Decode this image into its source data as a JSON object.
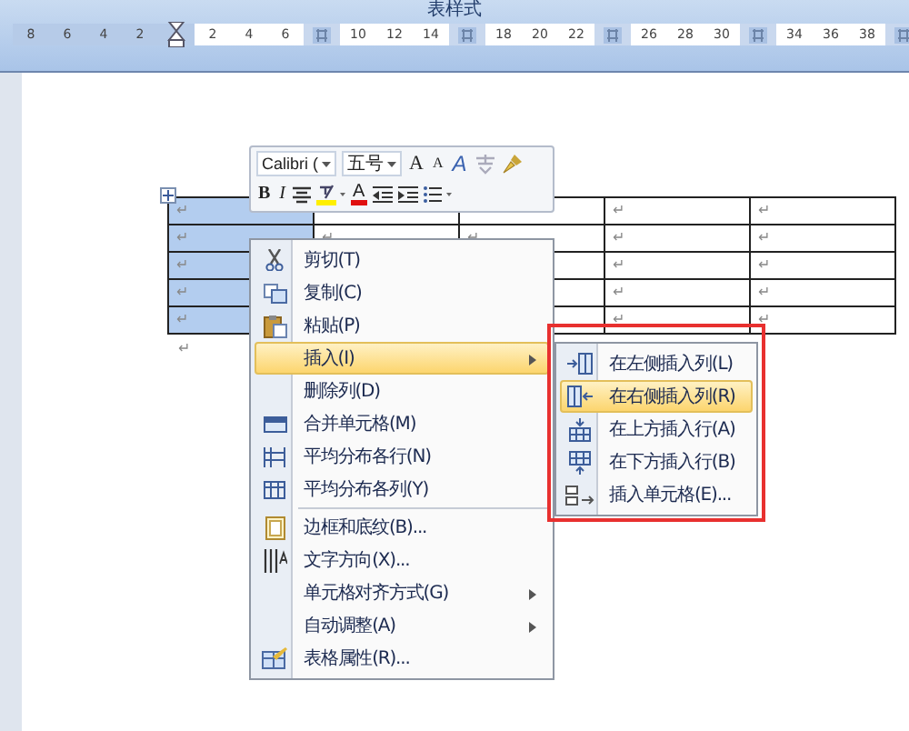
{
  "title": "表样式",
  "ruler": [
    {
      "kind": "number",
      "label": "8",
      "in_margin": true
    },
    {
      "kind": "number",
      "label": "6",
      "in_margin": true
    },
    {
      "kind": "number",
      "label": "4",
      "in_margin": true
    },
    {
      "kind": "number",
      "label": "2",
      "in_margin": true
    },
    {
      "kind": "indent_marker"
    },
    {
      "kind": "number",
      "label": "2",
      "in_margin": false
    },
    {
      "kind": "number",
      "label": "4",
      "in_margin": false
    },
    {
      "kind": "number",
      "label": "6",
      "in_margin": false
    },
    {
      "kind": "column_marker"
    },
    {
      "kind": "number",
      "label": "10",
      "in_margin": false
    },
    {
      "kind": "number",
      "label": "12",
      "in_margin": false
    },
    {
      "kind": "number",
      "label": "14",
      "in_margin": false
    },
    {
      "kind": "column_marker"
    },
    {
      "kind": "number",
      "label": "18",
      "in_margin": false
    },
    {
      "kind": "number",
      "label": "20",
      "in_margin": false
    },
    {
      "kind": "number",
      "label": "22",
      "in_margin": false
    },
    {
      "kind": "column_marker"
    },
    {
      "kind": "number",
      "label": "26",
      "in_margin": false
    },
    {
      "kind": "number",
      "label": "28",
      "in_margin": false
    },
    {
      "kind": "number",
      "label": "30",
      "in_margin": false
    },
    {
      "kind": "column_marker"
    },
    {
      "kind": "number",
      "label": "34",
      "in_margin": false
    },
    {
      "kind": "number",
      "label": "36",
      "in_margin": false
    },
    {
      "kind": "number",
      "label": "38",
      "in_margin": false
    },
    {
      "kind": "column_marker"
    }
  ],
  "table": {
    "rows": [
      [
        {
          "text": "↵",
          "selected": true
        },
        {},
        {},
        {
          "text": "↵",
          "selected": false
        },
        {
          "text": "↵",
          "selected": false
        }
      ],
      [
        {
          "text": "↵",
          "selected": true
        },
        {
          "text": "↵",
          "selected": false
        },
        {
          "text": "↵",
          "selected": false
        },
        {
          "text": "↵",
          "selected": false
        },
        {
          "text": "↵",
          "selected": false
        }
      ],
      [
        {
          "text": "↵",
          "selected": true
        },
        {},
        {},
        {
          "text": "↵",
          "selected": false
        },
        {
          "text": "↵",
          "selected": false
        }
      ],
      [
        {
          "text": "↵",
          "selected": true
        },
        {},
        {},
        {
          "text": "↵",
          "selected": false
        },
        {
          "text": "↵",
          "selected": false
        }
      ],
      [
        {
          "text": "↵",
          "selected": true
        },
        {},
        {},
        {
          "text": "↵",
          "selected": false
        },
        {
          "text": "↵",
          "selected": false
        }
      ]
    ],
    "after_mark": "↵"
  },
  "mini_toolbar": {
    "top_row": [
      {
        "kind": "font_field",
        "label": "Calibri ("
      },
      {
        "kind": "size_field",
        "label": "五号"
      },
      {
        "kind": "grow",
        "label": "A"
      },
      {
        "kind": "shrink",
        "label": "A"
      },
      {
        "kind": "styles",
        "label": "A"
      },
      {
        "kind": "phonetic"
      },
      {
        "kind": "painter"
      }
    ],
    "bottom_row": [
      {
        "kind": "bold",
        "label": "B"
      },
      {
        "kind": "italic",
        "label": "I"
      },
      {
        "kind": "center"
      },
      {
        "kind": "highlight"
      },
      {
        "kind": "font_color",
        "label": "A"
      },
      {
        "kind": "outdent"
      },
      {
        "kind": "indent"
      },
      {
        "kind": "bullets"
      }
    ]
  },
  "context_menu": {
    "items": [
      {
        "label": "剪切(T)",
        "kind": "cut",
        "submenu": false,
        "selected": false
      },
      {
        "label": "复制(C)",
        "kind": "copy",
        "submenu": false,
        "selected": false
      },
      {
        "label": "粘贴(P)",
        "kind": "paste",
        "submenu": false,
        "selected": false
      },
      {
        "label": "插入(I)",
        "kind": "plain",
        "submenu": true,
        "selected": true
      },
      {
        "label": "删除列(D)",
        "kind": "plain",
        "submenu": false,
        "selected": false
      },
      {
        "label": "合并单元格(M)",
        "kind": "merge",
        "submenu": false,
        "selected": false
      },
      {
        "label": "平均分布各行(N)",
        "kind": "rows",
        "submenu": false,
        "selected": false
      },
      {
        "label": "平均分布各列(Y)",
        "kind": "cols",
        "submenu": false,
        "selected": false
      },
      {
        "kind": "separator"
      },
      {
        "label": "边框和底纹(B)...",
        "kind": "borders",
        "submenu": false,
        "selected": false
      },
      {
        "label": "文字方向(X)...",
        "kind": "direction",
        "submenu": false,
        "selected": false
      },
      {
        "label": "单元格对齐方式(G)",
        "kind": "plain",
        "submenu": true,
        "selected": false
      },
      {
        "label": "自动调整(A)",
        "kind": "plain",
        "submenu": true,
        "selected": false
      },
      {
        "label": "表格属性(R)...",
        "kind": "properties",
        "submenu": false,
        "selected": false
      }
    ]
  },
  "submenu": {
    "items": [
      {
        "label": "在左侧插入列(L)",
        "kind": "col_left",
        "selected": false
      },
      {
        "label": "在右侧插入列(R)",
        "kind": "col_right",
        "selected": true
      },
      {
        "label": "在上方插入行(A)",
        "kind": "row_above",
        "selected": false
      },
      {
        "label": "在下方插入行(B)",
        "kind": "row_below",
        "selected": false
      },
      {
        "label": "插入单元格(E)...",
        "kind": "cell",
        "selected": false
      }
    ]
  }
}
